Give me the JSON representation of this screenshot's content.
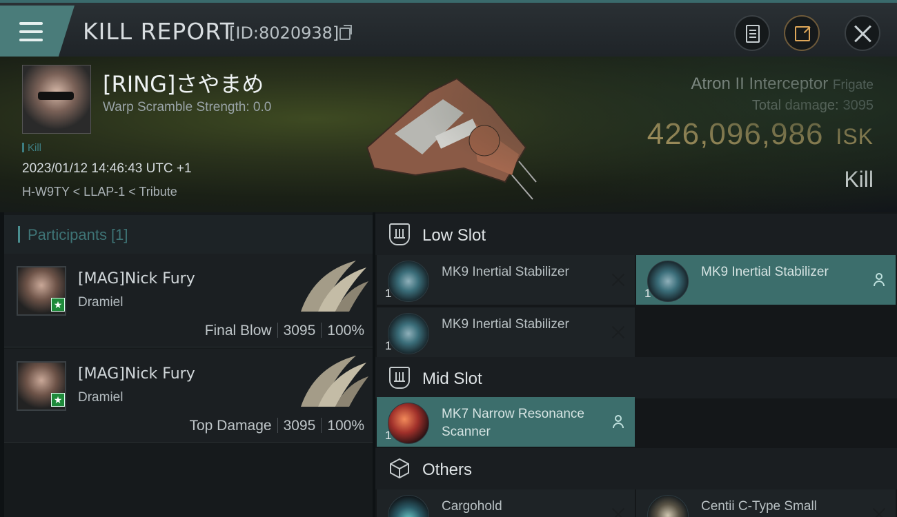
{
  "header": {
    "title": "KILL REPORT",
    "report_id": "[ID:8020938]"
  },
  "victim": {
    "name": "[RING]さやまめ",
    "warp_scramble": "Warp Scramble Strength: 0.0",
    "kill_tag": "Kill",
    "datetime": "2023/01/12 14:46:43 UTC +1",
    "location": "H-W9TY < LLAP-1 < Tribute"
  },
  "ship": {
    "name": "Atron II Interceptor",
    "class": "Frigate",
    "total_damage_label": "Total damage:",
    "total_damage": "3095",
    "isk_value": "426,096,986",
    "isk_unit": "ISK",
    "result": "Kill"
  },
  "participants": {
    "title": "Participants [1]",
    "items": [
      {
        "name": "[MAG]Nick Fury",
        "ship": "Dramiel",
        "role": "Final Blow",
        "damage": "3095",
        "percent": "100%"
      },
      {
        "name": "[MAG]Nick Fury",
        "ship": "Dramiel",
        "role": "Top Damage",
        "damage": "3095",
        "percent": "100%"
      }
    ]
  },
  "slots": {
    "low": {
      "title": "Low Slot",
      "modules": [
        {
          "name": "MK9 Inertial Stabilizer",
          "qty": "1",
          "status": "destroyed"
        },
        {
          "name": "MK9 Inertial Stabilizer",
          "qty": "1",
          "status": "dropped"
        },
        {
          "name": "MK9 Inertial Stabilizer",
          "qty": "1",
          "status": "destroyed"
        }
      ]
    },
    "mid": {
      "title": "Mid Slot",
      "modules": [
        {
          "name": "MK7 Narrow Resonance Scanner",
          "qty": "1",
          "status": "dropped"
        }
      ]
    },
    "others": {
      "title": "Others",
      "modules": [
        {
          "name": "Cargohold",
          "qty": "",
          "status": "destroyed"
        },
        {
          "name": "Centii C-Type Small",
          "qty": "",
          "status": "destroyed"
        }
      ]
    }
  },
  "colors": {
    "accent": "#4a7c7a",
    "isk": "#e6c27a",
    "dropped_bg": "#3c6e6c"
  }
}
